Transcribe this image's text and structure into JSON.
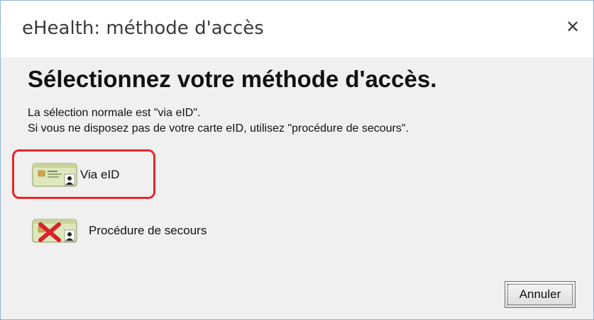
{
  "window": {
    "title": "eHealth: méthode d'accès",
    "close_glyph": "✕"
  },
  "main": {
    "heading": "Sélectionnez votre méthode d'accès.",
    "description_line1": "La sélection normale est \"via eID\".",
    "description_line2": "Si vous ne disposez pas de votre carte eID, utilisez \"procédure de secours\"."
  },
  "options": [
    {
      "label": "Via eID",
      "icon": "eid-card-icon",
      "highlighted": true
    },
    {
      "label": "Procédure de secours",
      "icon": "eid-card-cross-icon",
      "highlighted": false
    }
  ],
  "buttons": {
    "cancel_label": "Annuler"
  },
  "colors": {
    "highlight": "#e8262b",
    "card": "#d8e2b0",
    "cross": "#d9232a"
  }
}
